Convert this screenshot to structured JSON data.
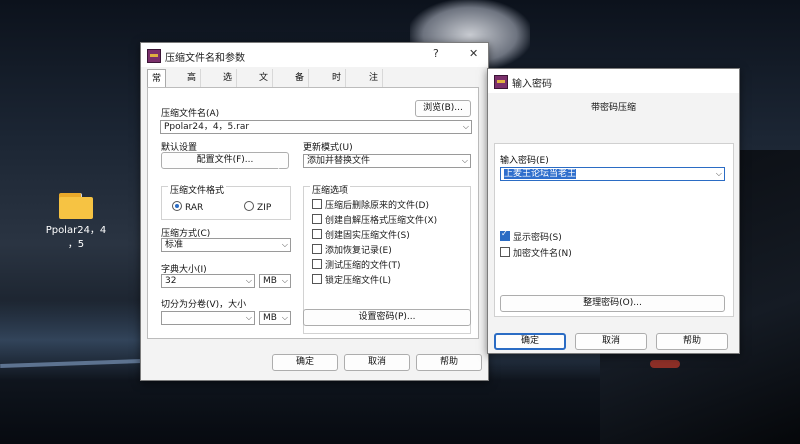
{
  "desktop": {
    "icon_label_1": "Ppolar24，4",
    "icon_label_2": "，5"
  },
  "archive_dialog": {
    "title": "压缩文件名和参数",
    "help_glyph": "?",
    "close_glyph": "✕",
    "tabs": [
      "常规",
      "高级",
      "选项",
      "文件",
      "备份",
      "时间",
      "注释"
    ],
    "archive_name_label": "压缩文件名(A)",
    "browse_label": "浏览(B)...",
    "archive_name_value": "Ppolar24，4，5.rar",
    "default_settings_label": "默认设置",
    "profiles_label": "配置文件(F)...",
    "update_mode_label": "更新模式(U)",
    "update_mode_value": "添加并替换文件",
    "format_label": "压缩文件格式",
    "format_rar": "RAR",
    "format_zip": "ZIP",
    "options_label": "压缩选项",
    "options": [
      {
        "label": "压缩后删除原来的文件(D)",
        "checked": false
      },
      {
        "label": "创建自解压格式压缩文件(X)",
        "checked": false
      },
      {
        "label": "创建固实压缩文件(S)",
        "checked": false
      },
      {
        "label": "添加恢复记录(E)",
        "checked": false
      },
      {
        "label": "测试压缩的文件(T)",
        "checked": false
      },
      {
        "label": "锁定压缩文件(L)",
        "checked": false
      }
    ],
    "method_label": "压缩方式(C)",
    "method_value": "标准",
    "dict_label": "字典大小(I)",
    "dict_value": "32",
    "dict_unit": "MB",
    "split_label": "切分为分卷(V)，大小",
    "split_value": "",
    "split_unit": "MB",
    "set_password_label": "设置密码(P)...",
    "ok_label": "确定",
    "cancel_label": "取消",
    "help_label": "帮助"
  },
  "password_dialog": {
    "title": "输入密码",
    "header": "带密码压缩",
    "password_label": "输入密码(E)",
    "password_value": "上麦王论坛当老王",
    "show_password_label": "显示密码(S)",
    "show_password_checked": true,
    "encrypt_names_label": "加密文件名(N)",
    "encrypt_names_checked": false,
    "organize_label": "整理密码(O)...",
    "ok_label": "确定",
    "cancel_label": "取消",
    "help_label": "帮助"
  }
}
